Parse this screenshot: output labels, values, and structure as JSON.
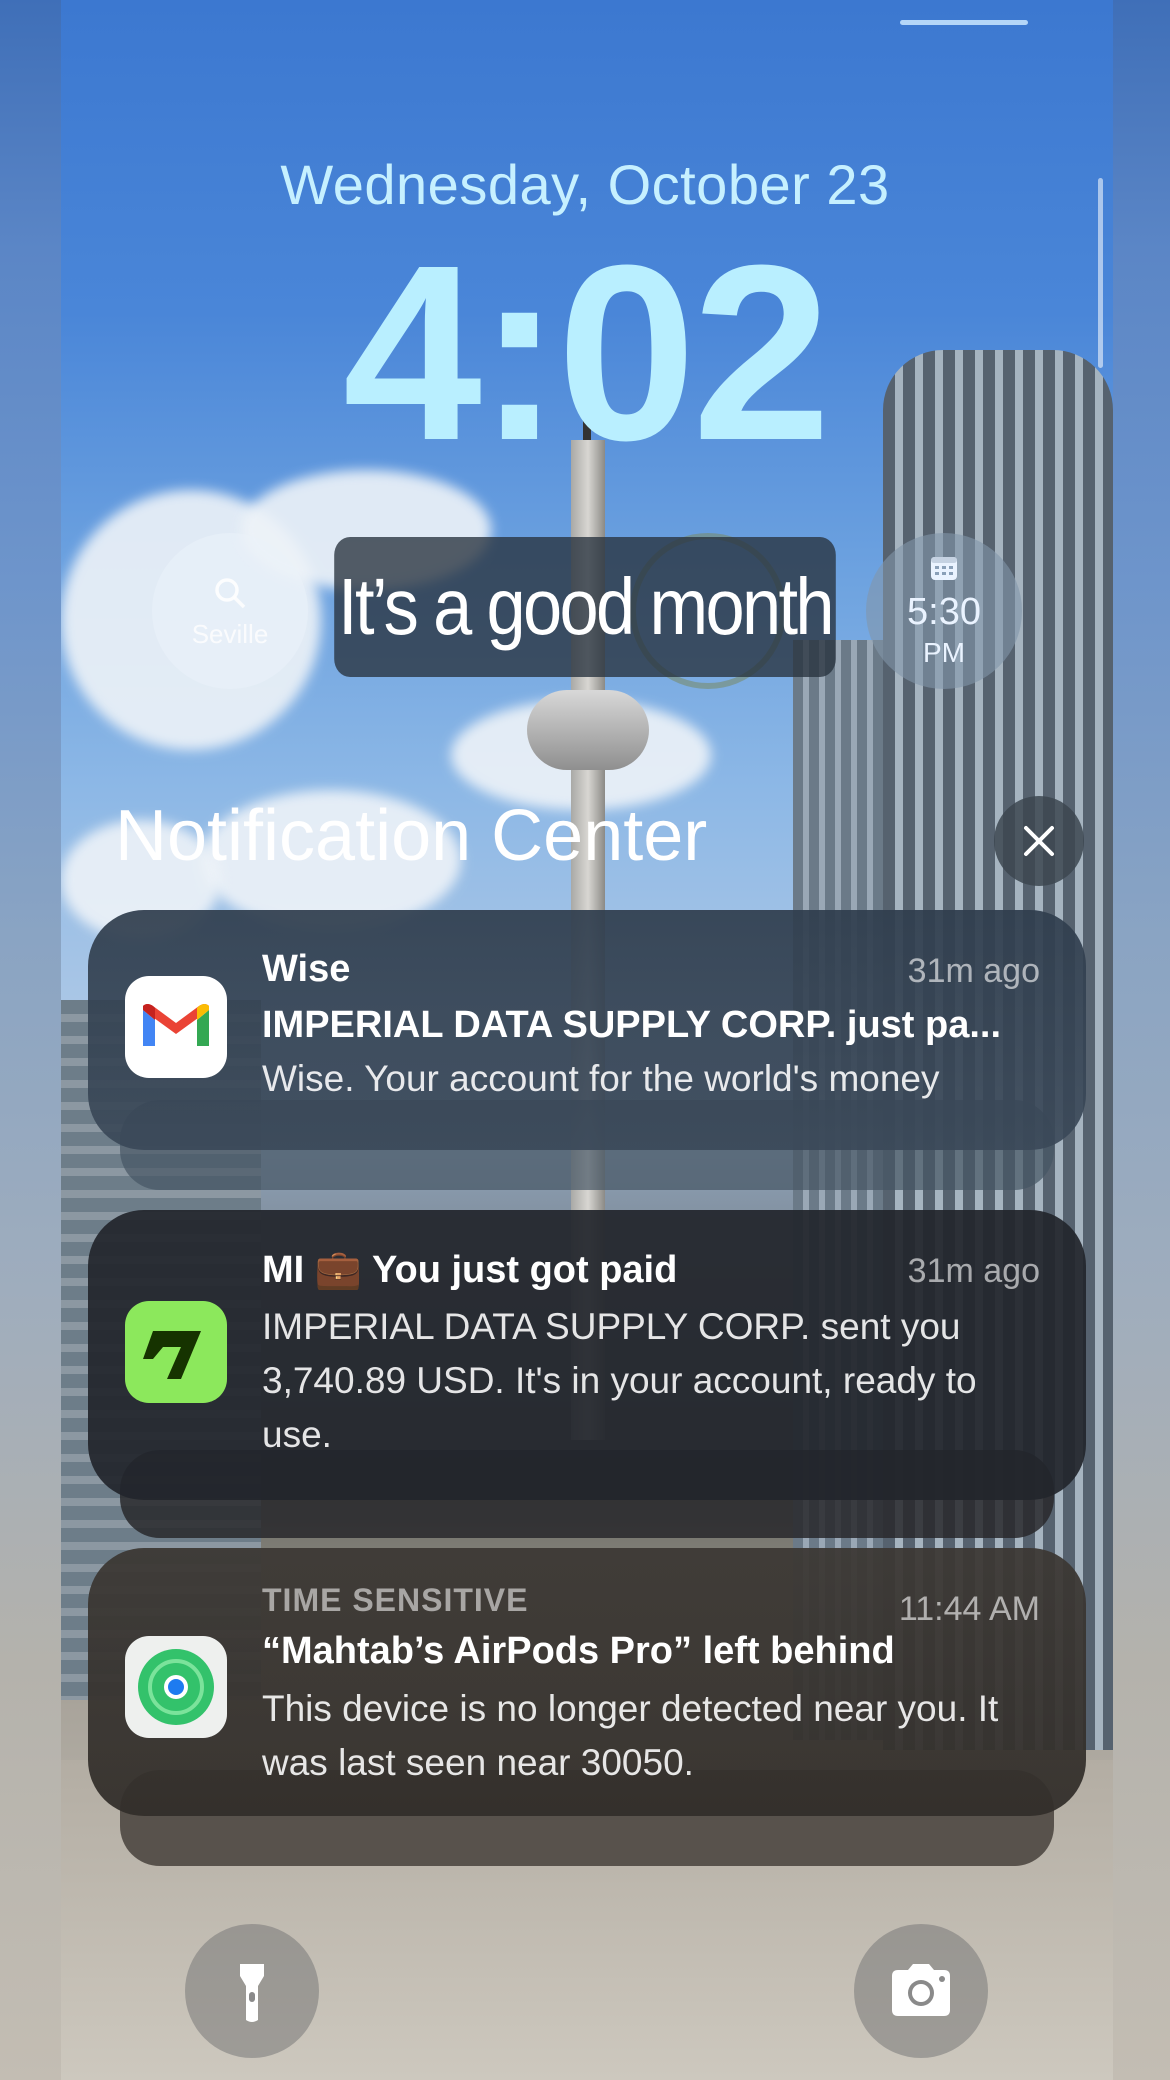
{
  "lock_screen": {
    "date": "Wednesday, October 23",
    "time": "4:02"
  },
  "widgets": {
    "search_label": "Seville",
    "calendar_time": "5:30",
    "calendar_ampm": "PM",
    "banner_text": "It’s a good month"
  },
  "notification_center": {
    "title": "Notification Center",
    "notifications": [
      {
        "app_icon": "gmail-icon",
        "title": "Wise",
        "time": "31m ago",
        "subtitle": "IMPERIAL DATA SUPPLY CORP. just pa...",
        "body": "Wise. Your account for the world's money"
      },
      {
        "app_icon": "wise-icon",
        "title": "MI 💼 You just got paid",
        "time": "31m ago",
        "body": "IMPERIAL DATA SUPPLY CORP. sent you 3,740.89 USD. It's in your account, ready to use."
      },
      {
        "app_icon": "find-my-icon",
        "category": "TIME SENSITIVE",
        "time": "11:44 AM",
        "title": "“Mahtab’s AirPods Pro” left behind",
        "body": "This device is no longer detected near you. It was last seen near 30050."
      }
    ]
  },
  "quick_actions": {
    "flashlight": "flashlight-icon",
    "camera": "camera-icon"
  }
}
